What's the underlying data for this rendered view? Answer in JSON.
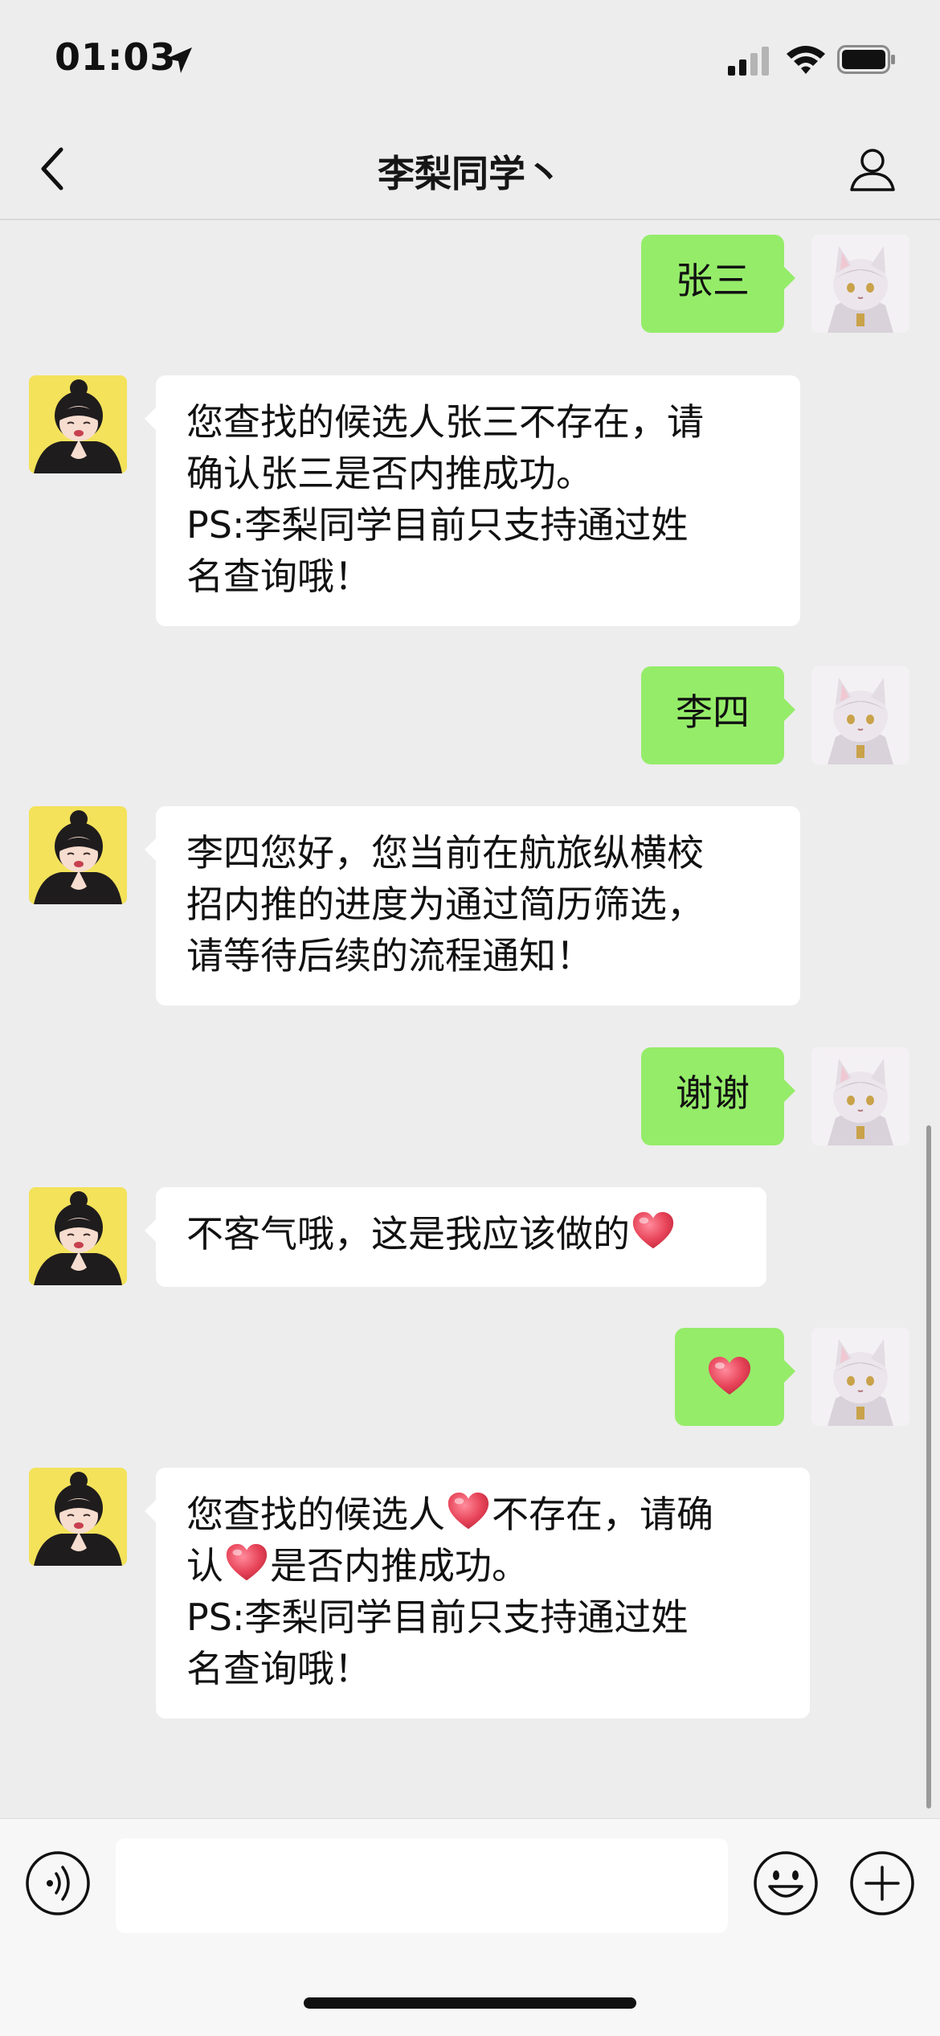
{
  "status_bar": {
    "time": "01:03"
  },
  "nav": {
    "title": "李梨同学丶",
    "back_icon": "chevron-left-icon",
    "profile_icon": "person-icon"
  },
  "messages": [
    {
      "side": "out",
      "segments": [
        "张三"
      ]
    },
    {
      "side": "in",
      "lines": [
        "您查找的候选人张三不存在，请",
        "确认张三是否内推成功。",
        "PS:李梨同学目前只支持通过姓",
        "名查询哦！"
      ]
    },
    {
      "side": "out",
      "segments": [
        "李四"
      ]
    },
    {
      "side": "in",
      "lines": [
        "李四您好，您当前在航旅纵横校",
        "招内推的进度为通过简历筛选，",
        "请等待后续的流程通知！"
      ]
    },
    {
      "side": "out",
      "segments": [
        "谢谢"
      ]
    },
    {
      "side": "in",
      "line_a": "不客气哦，这是我应该做的",
      "emoji": "heart-emoji"
    },
    {
      "side": "out",
      "emoji": "heart-emoji"
    },
    {
      "side": "in",
      "line_a1": "您查找的候选人",
      "line_a2": "不存在，请确",
      "line_b1": "认",
      "line_b2": "是否内推成功。",
      "line_c": "PS:李梨同学目前只支持通过姓",
      "line_d": "名查询哦！"
    }
  ],
  "input_bar": {
    "placeholder": "",
    "voice_icon": "voice-icon",
    "emoji_icon": "emoji-icon",
    "plus_icon": "plus-icon"
  },
  "colors": {
    "background": "#ededed",
    "outgoing_bubble": "#95ec69",
    "incoming_bubble": "#ffffff",
    "heart": "#e8455a"
  }
}
